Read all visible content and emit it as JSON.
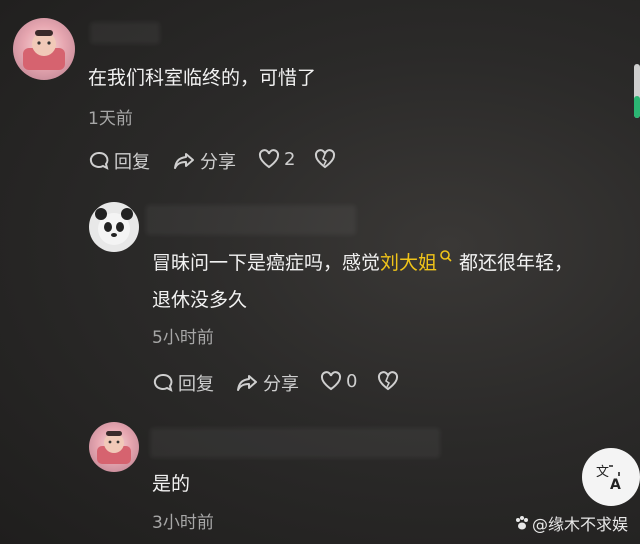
{
  "comments": [
    {
      "text": "在我们科室临终的，可惜了",
      "time": "1天前",
      "reply_label": "回复",
      "share_label": "分享",
      "like_count": "2"
    },
    {
      "text_before": "冒昧问一下是癌症吗，感觉",
      "mention": "刘大姐",
      "text_after": "都还很年轻，",
      "text_line2": "退休没多久",
      "time": "5小时前",
      "reply_label": "回复",
      "share_label": "分享",
      "like_count": "0"
    },
    {
      "text": "是的",
      "time": "3小时前"
    }
  ],
  "watermark": "@缘木不求娱",
  "translate_icon": "translate-icon",
  "colors": {
    "mention": "#f0c419",
    "accent_bar": "#2bb673"
  }
}
